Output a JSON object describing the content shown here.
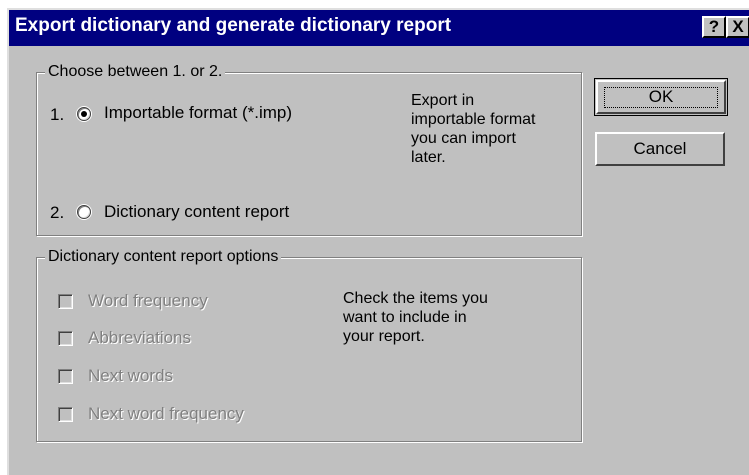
{
  "window": {
    "title": "Export dictionary and generate dictionary report",
    "help_glyph": "?",
    "close_glyph": "X"
  },
  "group_choose": {
    "legend": "Choose between 1. or 2.",
    "option1": {
      "number": "1.",
      "label": "Importable format (*.imp)",
      "selected": true
    },
    "option2": {
      "number": "2.",
      "label": "Dictionary content report",
      "selected": false
    },
    "description": "Export in\nimportable format\nyou can import\nlater."
  },
  "group_report": {
    "legend": "Dictionary content report options",
    "items": [
      {
        "label": "Word frequency",
        "checked": false,
        "enabled": false
      },
      {
        "label": "Abbreviations",
        "checked": false,
        "enabled": false
      },
      {
        "label": "Next words",
        "checked": false,
        "enabled": false
      },
      {
        "label": "Next word frequency",
        "checked": false,
        "enabled": false
      }
    ],
    "description": "Check the items you\nwant to include in\nyour report."
  },
  "buttons": {
    "ok": "OK",
    "cancel": "Cancel"
  },
  "colors": {
    "titlebar": "#000080",
    "face": "#c0c0c0",
    "disabled_text": "#808080"
  }
}
